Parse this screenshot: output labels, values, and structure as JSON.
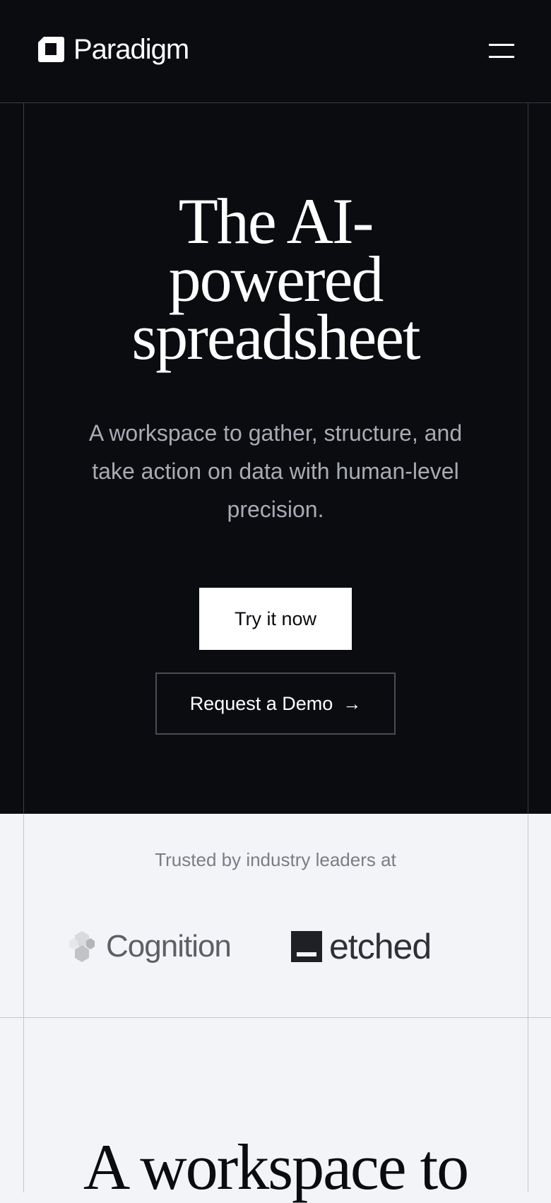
{
  "header": {
    "brand": "Paradigm",
    "menu_icon": "hamburger-menu-icon"
  },
  "hero": {
    "title_line1": "The AI-",
    "title_line2": "powered",
    "title_line3": "spreadsheet",
    "subtitle": "A workspace to gather, structure, and take action on data with human-level precision.",
    "primary_cta": "Try it now",
    "secondary_cta": "Request a Demo",
    "secondary_cta_icon": "arrow-right-icon"
  },
  "trusted": {
    "label": "Trusted by industry leaders at",
    "logos": [
      {
        "name": "Cognition",
        "icon": "cognition-logo-icon"
      },
      {
        "name": "etched",
        "icon": "etched-logo-icon"
      }
    ]
  },
  "next_section": {
    "title": "A workspace to"
  },
  "colors": {
    "dark_bg": "#0b0c10",
    "light_bg": "#f3f4f7",
    "primary_button_bg": "#ffffff",
    "text_light": "#ffffff",
    "subtitle_gray": "#a9abb3",
    "grid_line_dark": "#3b3d45",
    "grid_line_light": "#c4c7d0"
  }
}
